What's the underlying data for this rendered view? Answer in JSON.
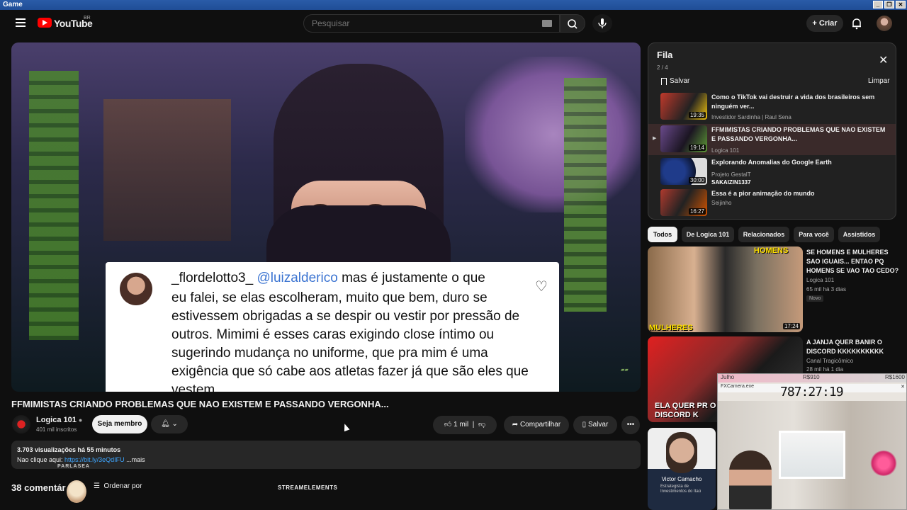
{
  "os": {
    "title": "Game",
    "buttons": [
      "_",
      "❐",
      "✕"
    ]
  },
  "header": {
    "logo_text": "YouTube",
    "country_code": "BR",
    "search_placeholder": "Pesquisar",
    "create_label": "+ Criar"
  },
  "video": {
    "comment_user": "_flordelotto3_",
    "comment_mention": "@luizalderico",
    "comment_first_line": "mas é justamente o que",
    "comment_text": "eu falei, se elas escolheram, muito que bem, duro se estivessem obrigadas a se despir ou vestir por pressão de outros. Mimimi é esses caras exigindo close íntimo ou sugerindo mudança no uniforme, que pra mim é uma exigência que só cabe aos atletas fazer já que são eles que vestem"
  },
  "meta": {
    "title": "FFMIMISTAS CRIANDO PROBLEMAS QUE NAO EXISTEM E PASSANDO VERGONHA...",
    "channel": "Logica 101",
    "subscribers": "401 mil inscritos",
    "member_label": "Seja membro",
    "likes": "1 mil",
    "share_label": "Compartilhar",
    "save_label": "Salvar",
    "views_time": "3.703 visualizações  há 55 minutos",
    "desc_prefix": "Nao clique aqui: ",
    "desc_link": "https://bit.ly/3eQdIFU",
    "desc_more": " ...mais",
    "overlay_parla": "PARLASEA",
    "comments_count": "38 comentár",
    "sort_label": "Ordenar por",
    "overlay_stream": "STREAMELEMENTS"
  },
  "queue": {
    "title": "Fila",
    "position": "2 / 4",
    "save_label": "Salvar",
    "clear_label": "Limpar",
    "items": [
      {
        "title": "Como o TikTok vai destruir a vida dos brasileiros sem ninguém ver...",
        "channel": "Investidor Sardinha | Raul Sena",
        "duration": "19:35"
      },
      {
        "title": "FFMIMISTAS CRIANDO PROBLEMAS QUE NAO EXISTEM E PASSANDO VERGONHA...",
        "channel": "Logica 101",
        "duration": "19:14"
      },
      {
        "title": "Explorando Anomalias do Google Earth",
        "channel": "Projeto GestalT",
        "overlay": "SAKAIZIN1337",
        "duration": "30:00"
      },
      {
        "title": "Essa é a pior animação do mundo",
        "channel": "Seijinho",
        "duration": "16:27"
      }
    ]
  },
  "chips": [
    "Todos",
    "De Logica 101",
    "Relacionados",
    "Para você",
    "Assistidos"
  ],
  "recommended": [
    {
      "title": "SE HOMENS E MULHERES SAO IGUAIS... ENTAO PQ HOMENS SE VAO TAO CEDO?",
      "channel": "Logica 101",
      "meta": "65 mil  há 3 dias",
      "badge": "Novo",
      "duration": "17:24",
      "thumb_caption_top": "HOMENS",
      "thumb_caption_bottom": "MULHERES"
    },
    {
      "title": "A JANJA QUER BANIR O DISCORD KKKKKKKKKK",
      "channel": "Canal Tragicômico",
      "meta": "28 mil  há 1 dia",
      "thumb_caption": "ELA QUER PR O DISCORD K"
    },
    {
      "title": "Victor Camacho",
      "channel": "Estrategista de Investimentos do Itaú"
    }
  ],
  "cam": {
    "header_left": "Julho",
    "header_mid": "R$910",
    "header_right": "R$1600",
    "window_title": "FXCamera.exe",
    "timer": "787:27:19"
  },
  "colors": {
    "accent": "#ff0000",
    "link": "#3ea6ff",
    "bg": "#0f0f0f"
  }
}
